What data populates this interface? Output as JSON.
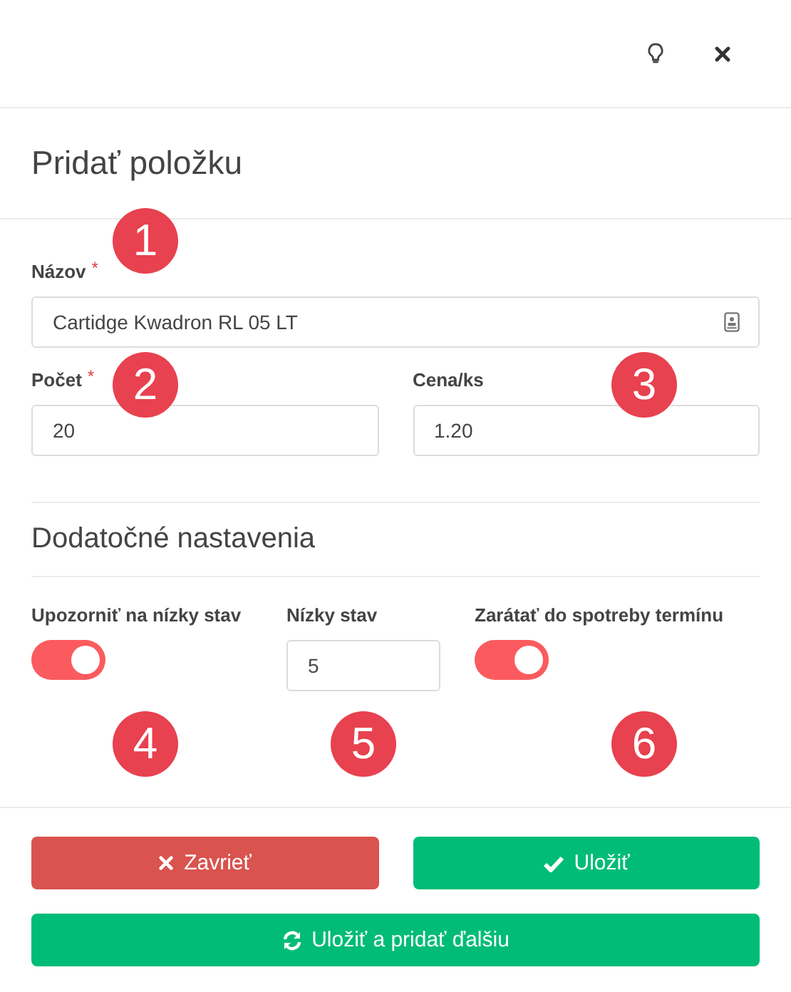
{
  "title": "Pridať položku",
  "fields": [
    {
      "label": "Názov",
      "required_mark": "*",
      "value": "Cartidge Kwadron RL 05 LT",
      "marker": "1"
    },
    {
      "label": "Počet",
      "required_mark": "*",
      "value": "20",
      "marker": "2"
    },
    {
      "label": "Cena/ks",
      "value": "1.20",
      "marker": "3"
    }
  ],
  "section_title": "Dodatočné nastavenia",
  "settings": [
    {
      "kind": "toggle",
      "label": "Upozorniť na nízky stav",
      "on": true,
      "marker": "4"
    },
    {
      "kind": "input",
      "label": "Nízky stav",
      "value": "5",
      "marker": "5"
    },
    {
      "kind": "toggle",
      "label": "Zarátať do spotreby termínu",
      "on": true,
      "marker": "6"
    }
  ],
  "buttons": [
    {
      "kind": "close",
      "label": "Zavrieť"
    },
    {
      "kind": "save",
      "label": "Uložiť"
    },
    {
      "kind": "save_add",
      "label": "Uložiť a pridať ďalšiu"
    }
  ]
}
